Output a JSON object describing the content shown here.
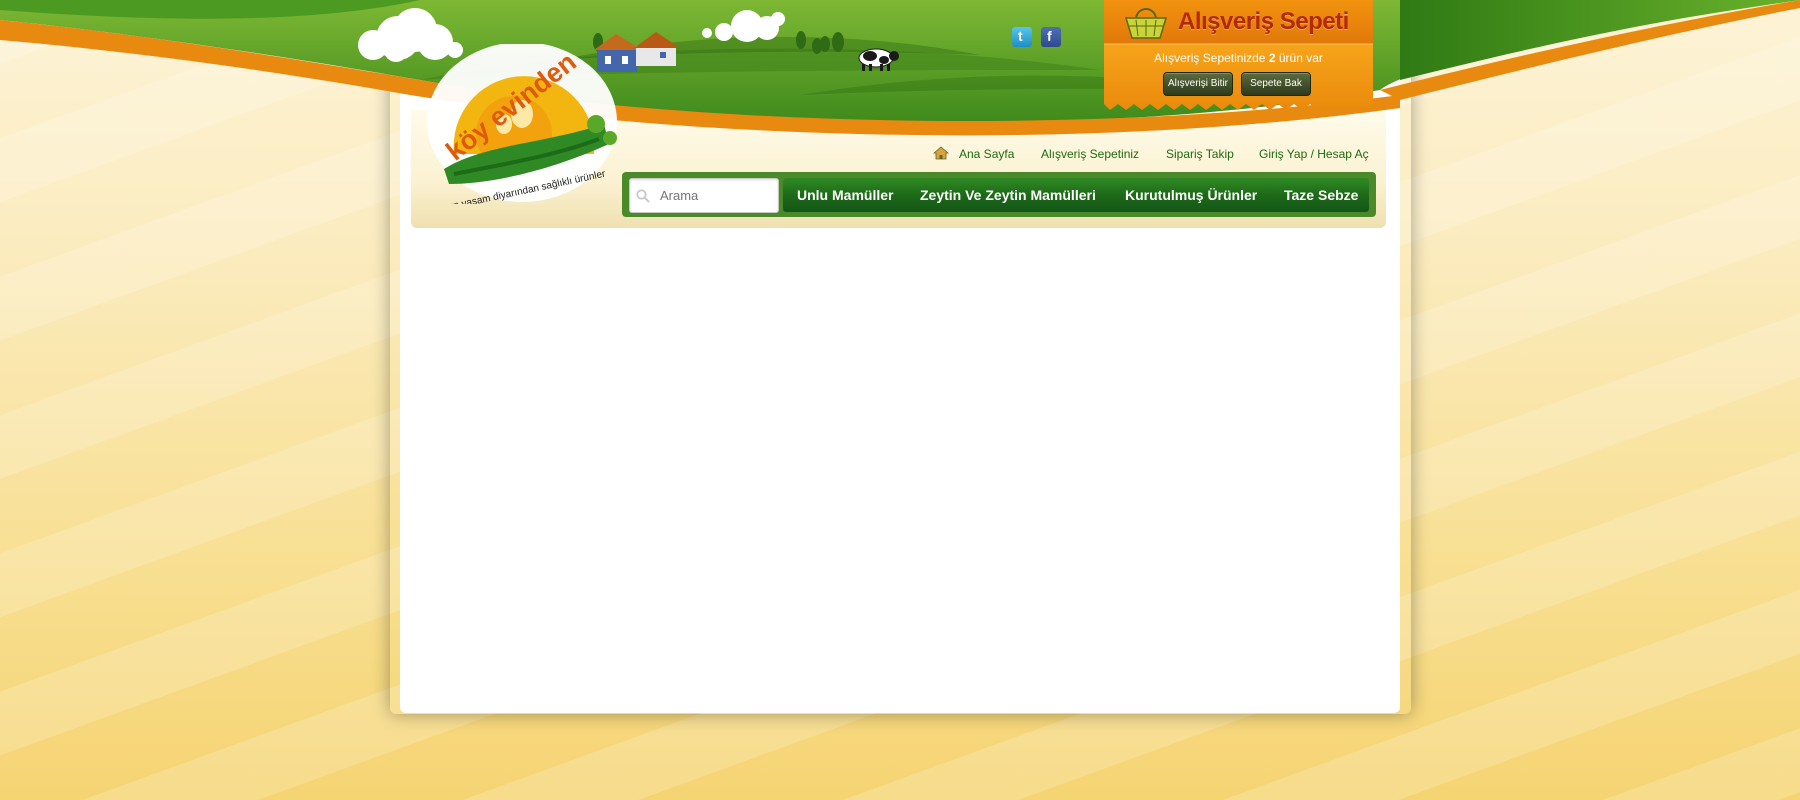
{
  "site": {
    "logo_text": "köy evinden",
    "logo_slogan": "uzun yaşam diyarından sağlıklı ürünler"
  },
  "cart": {
    "title": "Alışveriş Sepeti",
    "summary_prefix": "Alışveriş Sepetinizde",
    "item_count": "2",
    "summary_suffix": "ürün var",
    "finish_label": "Alışverişi Bitir",
    "view_label": "Sepete Bak",
    "icon": "basket-icon"
  },
  "social": {
    "twitter_icon": "twitter-icon",
    "facebook_icon": "facebook-icon"
  },
  "top_links": {
    "home": "Ana Sayfa",
    "cart": "Alışveriş Sepetiniz",
    "track": "Sipariş Takip",
    "login": "Giriş Yap / Hesap Aç"
  },
  "search": {
    "placeholder": "Arama"
  },
  "menu": {
    "items": [
      {
        "label": "Unlu Mamüller"
      },
      {
        "label": "Zeytin Ve Zeytin Mamülleri"
      },
      {
        "label": "Kurutulmuş Ürünler"
      },
      {
        "label": "Taze Sebze"
      }
    ]
  },
  "colors": {
    "accent_green": "#1d6a17",
    "accent_orange": "#e98a10",
    "cart_title": "#b52a06"
  }
}
